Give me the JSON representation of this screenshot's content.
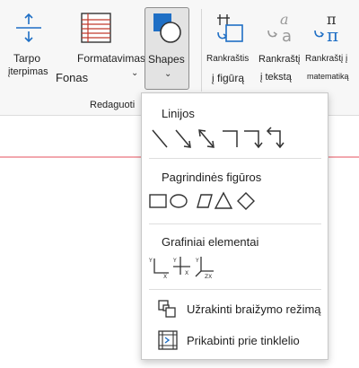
{
  "ribbon": {
    "group_label": "Redaguoti",
    "buttons": {
      "spacing_line1": "Tarpo",
      "spacing_line2": "įterpimas",
      "format_line1": "Formatavimas",
      "format_line2": "Fonas",
      "shapes": "Shapes",
      "handwriting_shape_line1": "Rankraštis",
      "handwriting_shape_line2": "į figūrą",
      "handwriting_text_line1": "Rankraštį",
      "handwriting_text_line2": "į tekstą",
      "handwriting_math_line1": "Rankraštį į",
      "handwriting_math_line2": "matematiką"
    }
  },
  "menu": {
    "lines_header": "Linijos",
    "basic_shapes_header": "Pagrindinės figūros",
    "graphs_header": "Grafiniai elementai",
    "lock_drawing": "Užrakinti braižymo režimą",
    "snap_to_grid": "Prikabinti prie tinklelio"
  },
  "colors": {
    "accent": "#1f6fc5",
    "icon_gray": "#555555",
    "red_line": "#f2a8ae"
  }
}
